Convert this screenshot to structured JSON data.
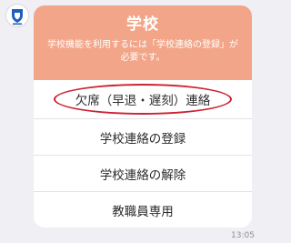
{
  "message": {
    "title": "学校",
    "description": "学校機能を利用するには「学校連絡の登録」が必要です。",
    "actions": [
      {
        "label": "欠席（早退・遅刻）連絡"
      },
      {
        "label": "学校連絡の登録"
      },
      {
        "label": "学校連絡の解除"
      },
      {
        "label": "教職員専用"
      }
    ],
    "timestamp": "13:05"
  },
  "colors": {
    "header": "#f2a588",
    "highlight": "#cc2230"
  },
  "icons": {
    "avatar": "city-emblem-icon"
  }
}
